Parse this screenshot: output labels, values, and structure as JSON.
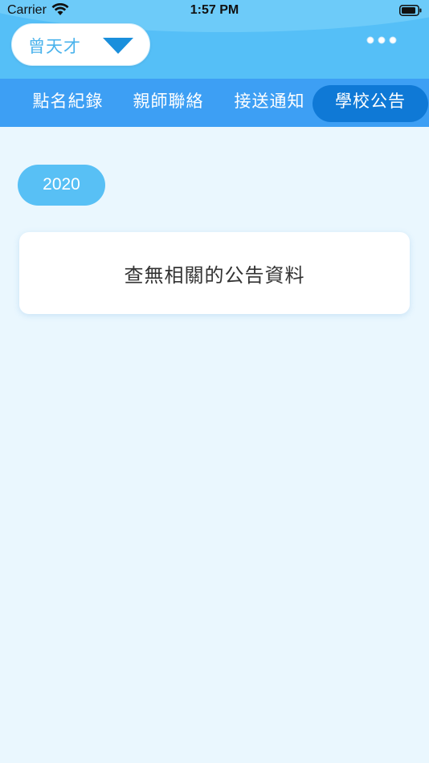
{
  "status_bar": {
    "carrier": "Carrier",
    "time": "1:57 PM"
  },
  "header": {
    "student_name": "曾天才",
    "dropdown_icon": "triangle-down-icon",
    "more_icon": "ellipsis-icon"
  },
  "tabs": [
    {
      "label": "點名紀錄",
      "active": false
    },
    {
      "label": "親師聯絡",
      "active": false
    },
    {
      "label": "接送通知",
      "active": false
    },
    {
      "label": "學校公告",
      "active": true
    }
  ],
  "content": {
    "year": "2020",
    "empty_message": "查無相關的公告資料"
  },
  "colors": {
    "header_bg": "#55bff7",
    "tab_bar_bg": "#3d9ff4",
    "tab_active_bg": "#0f79d6",
    "page_bg": "#eaf7fe",
    "accent": "#4ab3ec",
    "dropdown_arrow": "#1a8fdc"
  }
}
